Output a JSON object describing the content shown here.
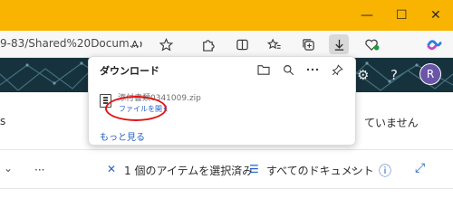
{
  "window": {
    "minimize_glyph": "—",
    "maximize_glyph": "☐",
    "close_glyph": "✕"
  },
  "address_bar": {
    "url_fragment": "9-83/Shared%20Docum..."
  },
  "toolbar_icons": [
    "read-aloud-icon",
    "favorite-star-icon",
    "extensions-icon",
    "split-screen-icon",
    "favorites-icon",
    "collections-icon",
    "downloads-icon",
    "performance-heart-icon",
    "copilot-icon"
  ],
  "downloads_panel": {
    "title": "ダウンロード",
    "file_name": "添付書類0341009.zip",
    "open_file_label": "ファイルを開く",
    "see_more_label": "もっと見る"
  },
  "page": {
    "settings_glyph": "⚙",
    "help_glyph": "?",
    "avatar_initial": "R",
    "right_text": "ていません",
    "left_char": "s",
    "command_bar": {
      "chevron": "⌄",
      "more": "···",
      "close_x": "✕",
      "selection_text": "1 個のアイテムを選択済み",
      "view_icon": "☰",
      "view_label": "すべてのドキュメント",
      "view_chevron": "⌄",
      "info": "ⓘ",
      "expand": "⤢"
    }
  },
  "colors": {
    "title_bar": "#f8b400",
    "banner": "#16323d",
    "link": "#1f5fbf",
    "annotation": "#e01515"
  }
}
